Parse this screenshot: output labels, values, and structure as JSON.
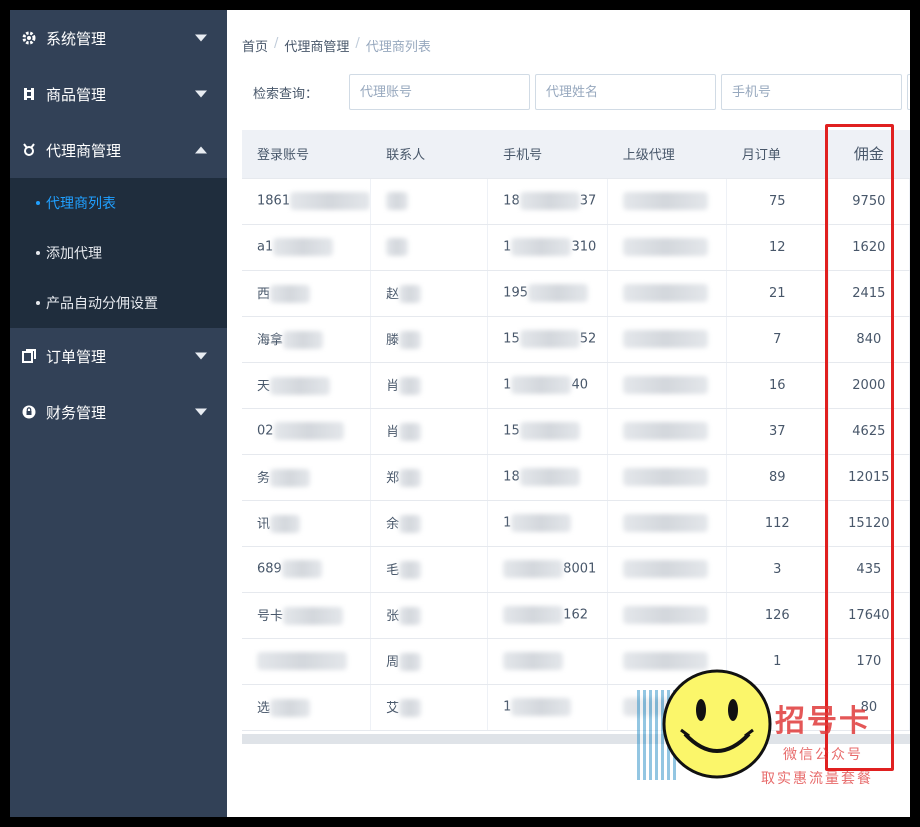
{
  "sidebar": {
    "menus": [
      {
        "label": "系统管理",
        "icon": "gear-icon",
        "expanded": false
      },
      {
        "label": "商品管理",
        "icon": "product-icon",
        "expanded": false
      },
      {
        "label": "代理商管理",
        "icon": "agent-icon",
        "expanded": true
      },
      {
        "label": "订单管理",
        "icon": "order-icon",
        "expanded": false
      },
      {
        "label": "财务管理",
        "icon": "finance-icon",
        "expanded": false
      }
    ],
    "submenu": [
      {
        "label": "代理商列表",
        "active": true
      },
      {
        "label": "添加代理",
        "active": false
      },
      {
        "label": "产品自动分佣设置",
        "active": false
      }
    ]
  },
  "breadcrumb": {
    "home": "首页",
    "level1": "代理商管理",
    "current": "代理商列表"
  },
  "search": {
    "label": "检索查询：",
    "account_placeholder": "代理账号",
    "name_placeholder": "代理姓名",
    "phone_placeholder": "手机号"
  },
  "table": {
    "headers": [
      "登录账号",
      "联系人",
      "手机号",
      "上级代理",
      "月订单",
      "佣金"
    ],
    "rows": [
      {
        "account": "1861",
        "contact": "",
        "phone": "18",
        "phone_tail": "37",
        "orders": "75",
        "commission": "9750"
      },
      {
        "account": "a1",
        "contact": "",
        "phone": "1",
        "phone_tail": "310",
        "orders": "12",
        "commission": "1620"
      },
      {
        "account": "西",
        "contact": "赵",
        "phone": "195",
        "phone_tail": "",
        "orders": "21",
        "commission": "2415"
      },
      {
        "account": "海拿",
        "contact": "滕",
        "phone": "15",
        "phone_tail": "52",
        "orders": "7",
        "commission": "840"
      },
      {
        "account": "天",
        "contact": "肖",
        "phone": "1",
        "phone_tail": "40",
        "orders": "16",
        "commission": "2000"
      },
      {
        "account": "02",
        "contact": "肖",
        "phone": "15",
        "phone_tail": "",
        "orders": "37",
        "commission": "4625"
      },
      {
        "account": "务",
        "contact": "郑",
        "phone": "18",
        "phone_tail": "",
        "orders": "89",
        "commission": "12015"
      },
      {
        "account": "讯",
        "contact": "余",
        "phone": "1",
        "phone_tail": "",
        "orders": "112",
        "commission": "15120"
      },
      {
        "account": "689",
        "contact": "毛",
        "phone": "",
        "phone_tail": "8001",
        "orders": "3",
        "commission": "435"
      },
      {
        "account": "号卡",
        "contact": "张",
        "phone": "",
        "phone_tail": "162",
        "orders": "126",
        "commission": "17640"
      },
      {
        "account": "",
        "contact": "周",
        "phone": "",
        "phone_tail": "",
        "orders": "1",
        "commission": "170"
      },
      {
        "account": "选",
        "contact": "艾",
        "phone": "1",
        "phone_tail": "",
        "orders": "",
        "commission": "80"
      }
    ]
  },
  "watermark": {
    "title": "招号卡",
    "line1": "微信公众号",
    "line2": "取实惠流量套餐"
  },
  "colors": {
    "sidebar": "#324157",
    "submenu": "#1f2d3d",
    "active": "#20a0ff",
    "highlight": "#e02020"
  }
}
